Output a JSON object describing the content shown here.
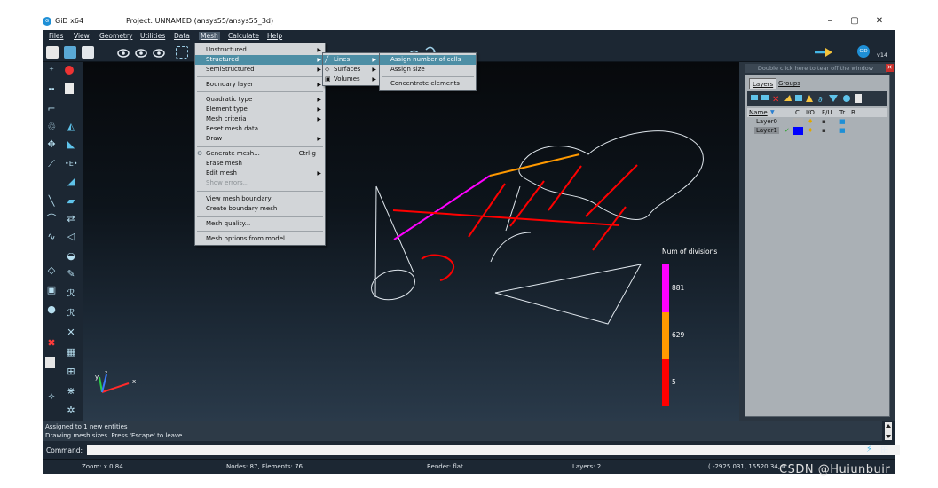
{
  "window": {
    "app_name": "GiD x64",
    "project_title": "Project: UNNAMED (ansys55/ansys55_3d)",
    "minimize": "–",
    "maximize": "▢",
    "close": "✕",
    "version_badge": "v14"
  },
  "menubar": {
    "items": [
      "Files",
      "View",
      "Geometry",
      "Utilities",
      "Data",
      "Mesh",
      "Calculate",
      "Help"
    ]
  },
  "mesh_menu": {
    "items": [
      {
        "label": "Unstructured",
        "sub": true
      },
      {
        "label": "Structured",
        "sub": true
      },
      {
        "label": "SemiStructured",
        "sub": true
      },
      {
        "label": "Boundary layer",
        "sub": true
      },
      {
        "label": "Quadratic type",
        "sub": true
      },
      {
        "label": "Element type",
        "sub": true
      },
      {
        "label": "Mesh criteria",
        "sub": true
      },
      {
        "label": "Reset mesh data",
        "sub": false
      },
      {
        "label": "Draw",
        "sub": true
      },
      {
        "label": "Generate mesh...",
        "sub": false,
        "accel": "Ctrl-g"
      },
      {
        "label": "Erase mesh",
        "sub": false
      },
      {
        "label": "Edit mesh",
        "sub": true
      },
      {
        "label": "Show errors...",
        "sub": false
      },
      {
        "label": "View mesh boundary",
        "sub": false
      },
      {
        "label": "Create boundary mesh",
        "sub": false
      },
      {
        "label": "Mesh quality...",
        "sub": false
      },
      {
        "label": "Mesh options from model",
        "sub": false
      }
    ]
  },
  "structured_submenu": {
    "items": [
      "Lines",
      "Surfaces",
      "Volumes"
    ]
  },
  "lines_submenu": {
    "items": [
      "Assign number of cells",
      "Assign size",
      "Concentrate elements"
    ]
  },
  "right_panel": {
    "tearoff": "Double click here to tear off the window",
    "tabs": [
      "Layers",
      "Groups"
    ],
    "columns": [
      "Name",
      "C",
      "I/O",
      "F/U",
      "Tr",
      "B"
    ],
    "layers": [
      {
        "name": "Layer0",
        "color": "#b0b0b0",
        "current": false
      },
      {
        "name": "Layer1",
        "color": "#0000ff",
        "current": true
      }
    ]
  },
  "legend": {
    "title": "Num of divisions",
    "entries": [
      {
        "label": "881",
        "color": "#ff00ff"
      },
      {
        "label": "629",
        "color": "#ff9900"
      },
      {
        "label": "5",
        "color": "#ff0000"
      }
    ]
  },
  "axes": {
    "x": "x",
    "y": "y",
    "z": "z"
  },
  "messages": [
    "Assigned to 1 new entities",
    "Drawing mesh sizes. Press 'Escape' to leave"
  ],
  "command": {
    "label": "Command:",
    "value": ""
  },
  "status": {
    "zoom": "Zoom: x 0.84",
    "nodes": "Nodes: 87, Elements: 76",
    "render": "Render: flat",
    "layers": "Layers: 2",
    "coords": "( -2925.031,  15520.34,  0"
  },
  "watermark": "CSDN @Huiunbuir"
}
